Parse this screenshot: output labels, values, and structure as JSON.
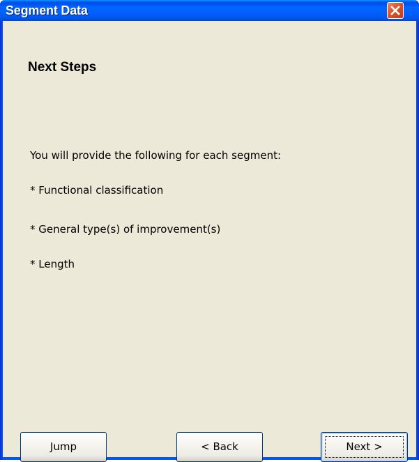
{
  "window": {
    "title": "Segment Data",
    "close_icon": "close-icon"
  },
  "content": {
    "heading": "Next Steps",
    "lines": [
      "You will provide the following for each segment:",
      "* Functional classification",
      "* General type(s) of improvement(s)",
      "* Length"
    ]
  },
  "buttons": {
    "jump_label": "Jump",
    "back_label": "< Back",
    "next_label": "Next >"
  },
  "colors": {
    "titlebar": "#0058ee",
    "dialog_bg": "#ece9d8",
    "close_button": "#d9542e"
  }
}
